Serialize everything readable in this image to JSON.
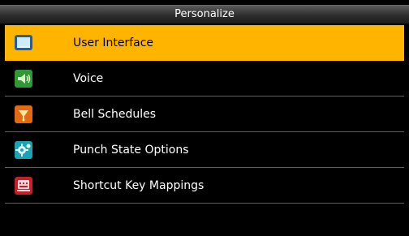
{
  "header": {
    "title": "Personalize"
  },
  "menu": {
    "items": [
      {
        "label": "User Interface",
        "icon": "monitor-icon"
      },
      {
        "label": "Voice",
        "icon": "speaker-icon"
      },
      {
        "label": "Bell Schedules",
        "icon": "bell-icon"
      },
      {
        "label": "Punch State Options",
        "icon": "gear-icon"
      },
      {
        "label": "Shortcut Key Mappings",
        "icon": "keyboard-key-icon"
      }
    ],
    "selected_index": 0
  },
  "colors": {
    "selected_background": "#ffb400",
    "background": "#000000",
    "text": "#ffffff"
  }
}
